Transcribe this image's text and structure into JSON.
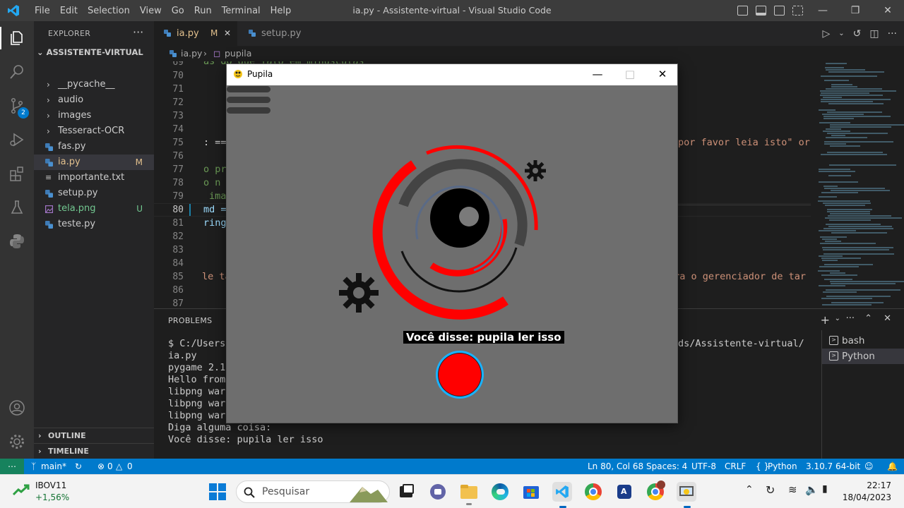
{
  "window": {
    "title": "ia.py - Assistente-virtual - Visual Studio Code",
    "menu": [
      "File",
      "Edit",
      "Selection",
      "View",
      "Go",
      "Run",
      "Terminal",
      "Help"
    ]
  },
  "activity": {
    "source_control_badge": "2"
  },
  "sidebar": {
    "header": "EXPLORER",
    "more": "···",
    "root": "ASSISTENTE-VIRTUAL",
    "items": [
      {
        "label": "__pycache__",
        "type": "folder",
        "status": ""
      },
      {
        "label": "audio",
        "type": "folder",
        "status": ""
      },
      {
        "label": "images",
        "type": "folder",
        "status": ""
      },
      {
        "label": "Tesseract-OCR",
        "type": "folder",
        "status": ""
      },
      {
        "label": "fas.py",
        "type": "python",
        "status": ""
      },
      {
        "label": "ia.py",
        "type": "python",
        "status": "M"
      },
      {
        "label": "importante.txt",
        "type": "text",
        "status": ""
      },
      {
        "label": "setup.py",
        "type": "python",
        "status": ""
      },
      {
        "label": "tela.png",
        "type": "image",
        "status": "U"
      },
      {
        "label": "teste.py",
        "type": "python",
        "status": ""
      }
    ],
    "outline": "OUTLINE",
    "timeline": "TIMELINE"
  },
  "tabs": [
    {
      "label": "ia.py",
      "status": "M",
      "active": true
    },
    {
      "label": "setup.py",
      "status": "",
      "active": false
    }
  ],
  "breadcrumb": {
    "file": "ia.py",
    "symbol": "pupila"
  },
  "code": {
    "line_numbers": [
      "69",
      "70",
      "71",
      "72",
      "73",
      "74",
      "75",
      "76",
      "77",
      "78",
      "79",
      "80",
      "81",
      "82",
      "83",
      "84",
      "85",
      "86",
      "87"
    ],
    "current_line": "80",
    "top_fragment": "as do que falo em minusculas",
    "l75_left": ": ==",
    "l75_right": "por favor leia isto\" or",
    "l77": "o pr",
    "l78": "o n",
    "l79": "ima",
    "l80": "md =",
    "l81": "ring",
    "l85_left": "le ta",
    "l85_right": "bra o gerenciador de tar"
  },
  "panel": {
    "tab_problems": "PROBLEMS",
    "terminal_left": [
      "$ C:/Users",
      "ia.py",
      "pygame 2.1",
      "Hello from",
      "libpng war",
      "libpng war",
      "libpng war",
      "Diga alguma coisa:",
      "Você disse: pupila ler isso"
    ],
    "terminal_right": "ds/Assistente-virtual/",
    "terminals": [
      {
        "label": "bash",
        "selected": false
      },
      {
        "label": "Python",
        "selected": true
      }
    ]
  },
  "statusbar": {
    "branch": "main*",
    "errors": "0",
    "warnings": "0",
    "position": "Ln 80, Col 68",
    "spaces": "Spaces: 4",
    "encoding": "UTF-8",
    "eol": "CRLF",
    "language": "Python",
    "interpreter": "3.10.7 64-bit"
  },
  "pupila": {
    "title": "Pupila",
    "said_text": "Você disse: pupila ler isso",
    "colors": {
      "red": "#ff0000",
      "ring_dark": "#444444",
      "ring_blue": "#5a6a86",
      "ring_blue_light": "#1ab2ff"
    }
  },
  "taskbar": {
    "stock_name": "IBOV11",
    "stock_change": "+1,56%",
    "search_placeholder": "Pesquisar",
    "time": "22:17",
    "date": "18/04/2023"
  },
  "colors": {
    "accent": "#007acc",
    "remote": "#16825d",
    "activity_bg": "#333333",
    "sidebar_bg": "#252526",
    "editor_bg": "#1e1e1e"
  }
}
